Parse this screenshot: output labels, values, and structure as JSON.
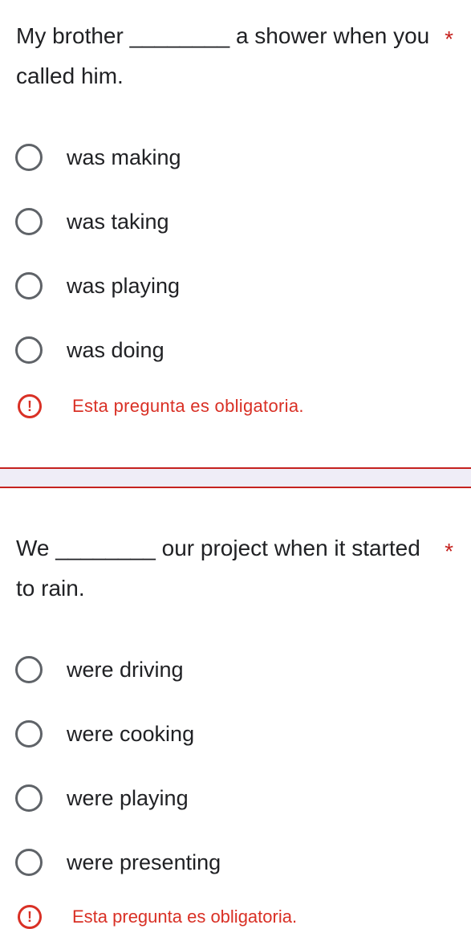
{
  "questions": [
    {
      "text": "My brother ________ a shower when you called him.",
      "required_marker": "*",
      "options": [
        "was making",
        "was taking",
        "was playing",
        "was doing"
      ],
      "error": "Esta pregunta es obligatoria."
    },
    {
      "text": "We ________ our project when it started to rain.",
      "required_marker": "*",
      "options": [
        "were driving",
        "were cooking",
        "were playing",
        "were presenting"
      ],
      "error": "Esta pregunta es obligatoria."
    }
  ],
  "icons": {
    "error_icon": "exclamation-circle",
    "radio_icon": "radio-unchecked"
  },
  "colors": {
    "error": "#d93025",
    "separator": "#efedf7",
    "radio_border": "#5f6368"
  }
}
